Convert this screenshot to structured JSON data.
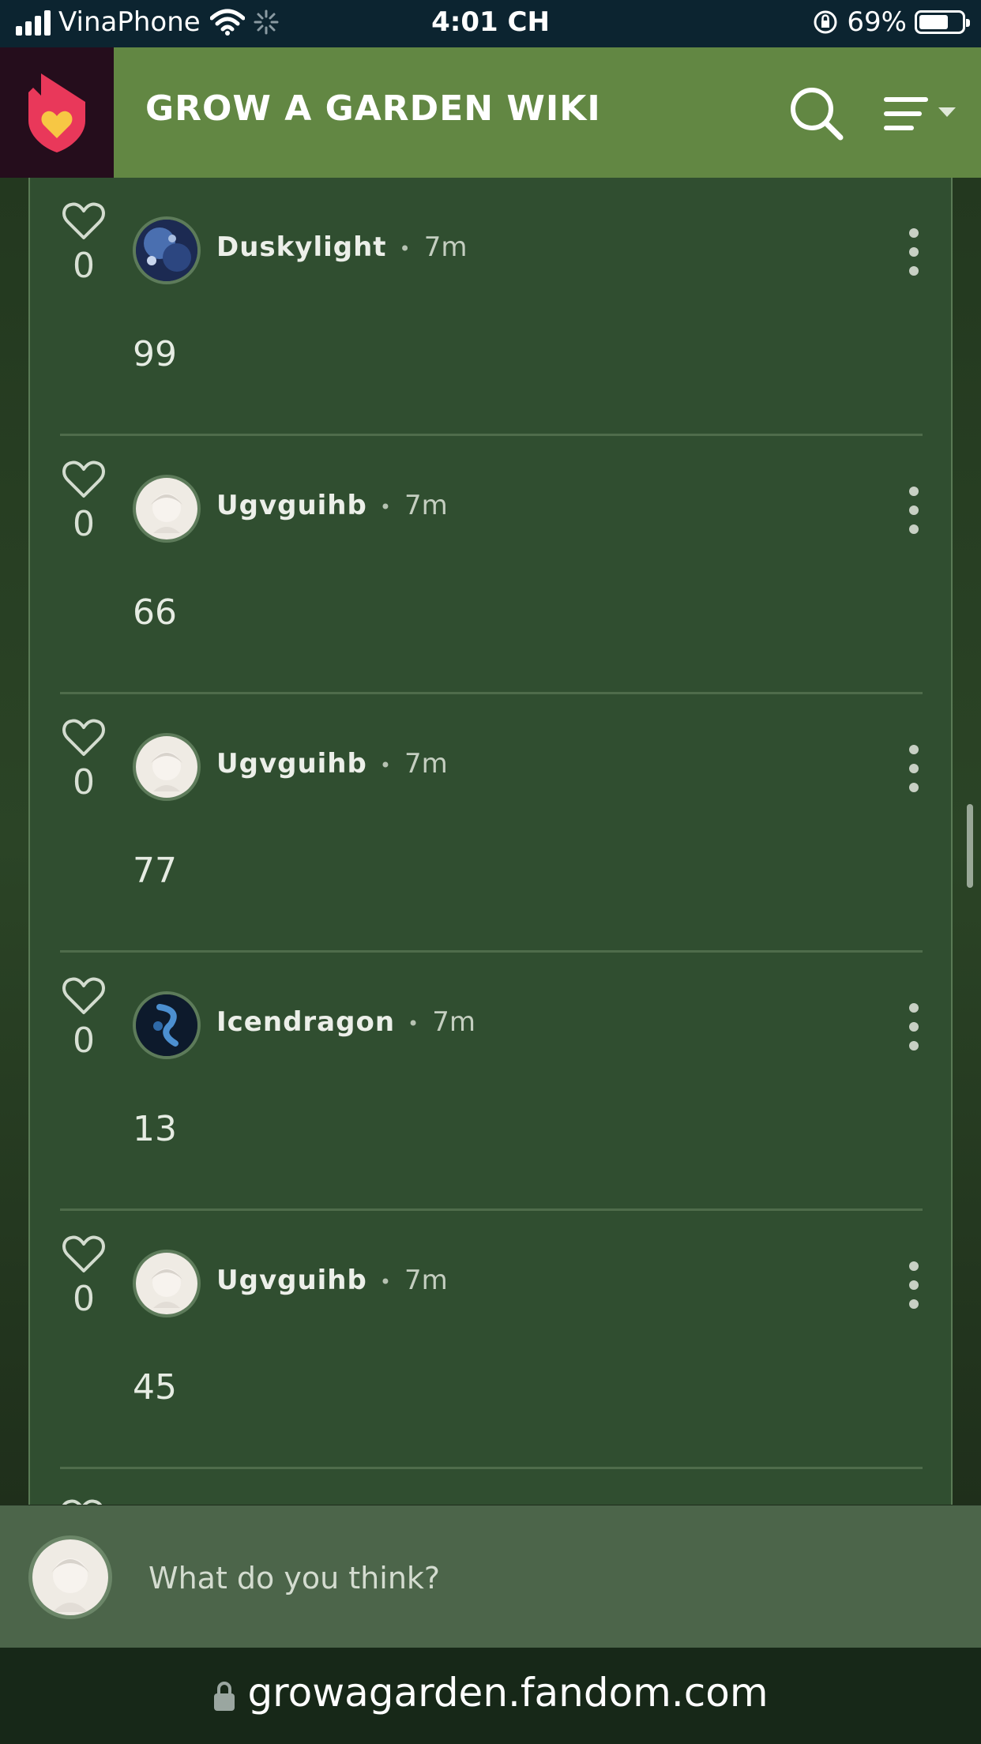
{
  "status_bar": {
    "carrier": "VinaPhone",
    "time": "4:01 CH",
    "battery": "69%",
    "battery_level": 0.69
  },
  "header": {
    "site_title": "GROW A GARDEN WIKI",
    "logo_icon": "fandom-heart-flame-icon",
    "search_icon": "search-icon",
    "menu_icon": "menu-icon"
  },
  "comments": [
    {
      "likes": "0",
      "author": "Duskylight",
      "separator": "•",
      "time": "7m",
      "text": "99"
    },
    {
      "likes": "0",
      "author": "Ugvguihb",
      "separator": "•",
      "time": "7m",
      "text": "66"
    },
    {
      "likes": "0",
      "author": "Ugvguihb",
      "separator": "•",
      "time": "7m",
      "text": "77"
    },
    {
      "likes": "0",
      "author": "Icendragon",
      "separator": "•",
      "time": "7m",
      "text": "13"
    },
    {
      "likes": "0",
      "author": "Ugvguihb",
      "separator": "•",
      "time": "7m",
      "text": "45"
    }
  ],
  "reply": {
    "placeholder": "What do you think?"
  },
  "url_bar": {
    "url": "growagarden.fandom.com"
  },
  "colors": {
    "header": "#628743",
    "panel": "#304e30",
    "logo_bg": "#250d1c",
    "accent_pink": "#e9385a",
    "accent_yellow": "#f7c744"
  }
}
